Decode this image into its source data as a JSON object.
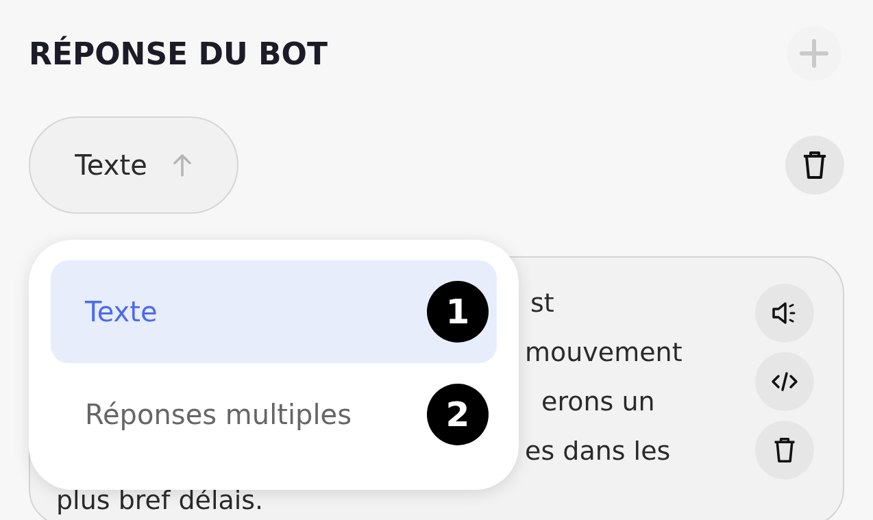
{
  "header": {
    "title": "RÉPONSE DU BOT"
  },
  "type_select": {
    "label": "Texte",
    "expanded": true
  },
  "message": {
    "lines": [
      "st",
      "mouvement",
      "erons un",
      "es dans les",
      "plus bref délais."
    ]
  },
  "menu": {
    "items": [
      {
        "label": "Texte",
        "shortcut": "1",
        "selected": true
      },
      {
        "label": "Réponses multiples",
        "shortcut": "2",
        "selected": false
      }
    ]
  }
}
